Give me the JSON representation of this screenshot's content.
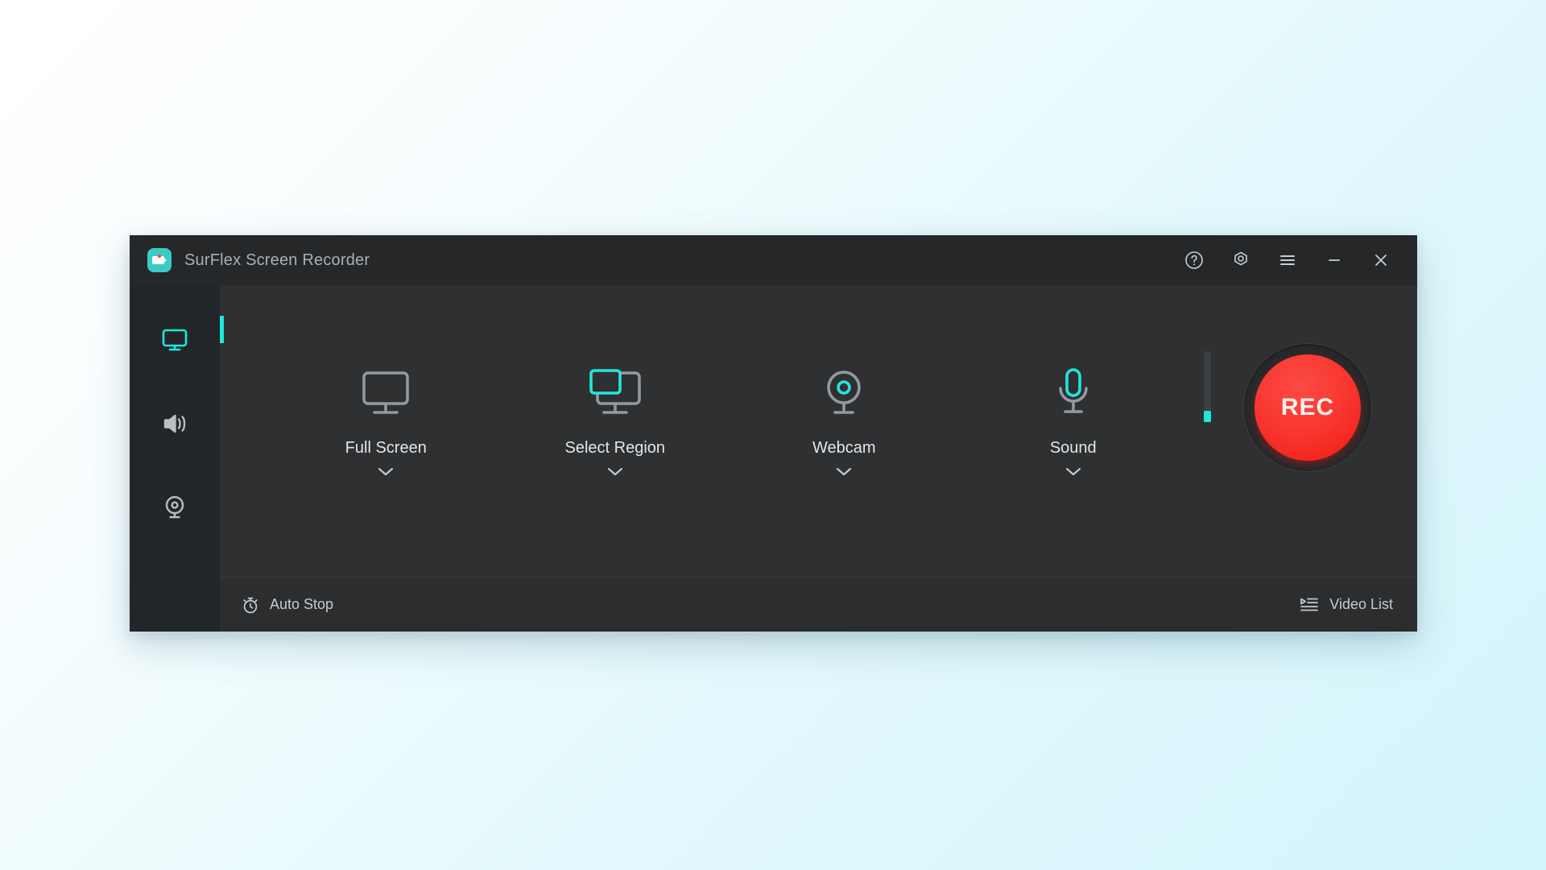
{
  "window": {
    "title": "SurFlex Screen Recorder",
    "app_icon": "camcorder-icon",
    "accent_color": "#22e6db",
    "record_color": "#f93a33",
    "titlebar_bg": "#252729",
    "content_bg": "#2e3032",
    "sidebar_bg": "#232629"
  },
  "titlebar_buttons": [
    {
      "name": "help-icon",
      "label": "Help"
    },
    {
      "name": "settings-icon",
      "label": "Settings"
    },
    {
      "name": "menu-icon",
      "label": "Menu"
    },
    {
      "name": "minimize-icon",
      "label": "Minimize"
    },
    {
      "name": "close-icon",
      "label": "Close"
    }
  ],
  "sidebar": {
    "items": [
      {
        "icon": "monitor-icon",
        "label": "Screen Recorder",
        "active": true
      },
      {
        "icon": "speaker-icon",
        "label": "Audio Recorder",
        "active": false
      },
      {
        "icon": "webcam-icon",
        "label": "Webcam Recorder",
        "active": false
      }
    ]
  },
  "modes": [
    {
      "icon": "monitor-icon",
      "label": "Full Screen",
      "chevron": "chevron-down-icon",
      "enabled": false
    },
    {
      "icon": "select-region-icon",
      "label": "Select Region",
      "chevron": "chevron-down-icon",
      "enabled": true
    },
    {
      "icon": "webcam-icon",
      "label": "Webcam",
      "chevron": "chevron-down-icon",
      "enabled": true
    },
    {
      "icon": "microphone-icon",
      "label": "Sound",
      "chevron": "chevron-down-icon",
      "enabled": true
    }
  ],
  "meter": {
    "name": "audio-level-meter",
    "level_percent": 16
  },
  "record": {
    "label": "REC",
    "name": "record-button"
  },
  "footer": {
    "auto_stop": {
      "label": "Auto Stop",
      "icon": "stopwatch-icon"
    },
    "video_list": {
      "label": "Video List",
      "icon": "playlist-icon"
    }
  }
}
